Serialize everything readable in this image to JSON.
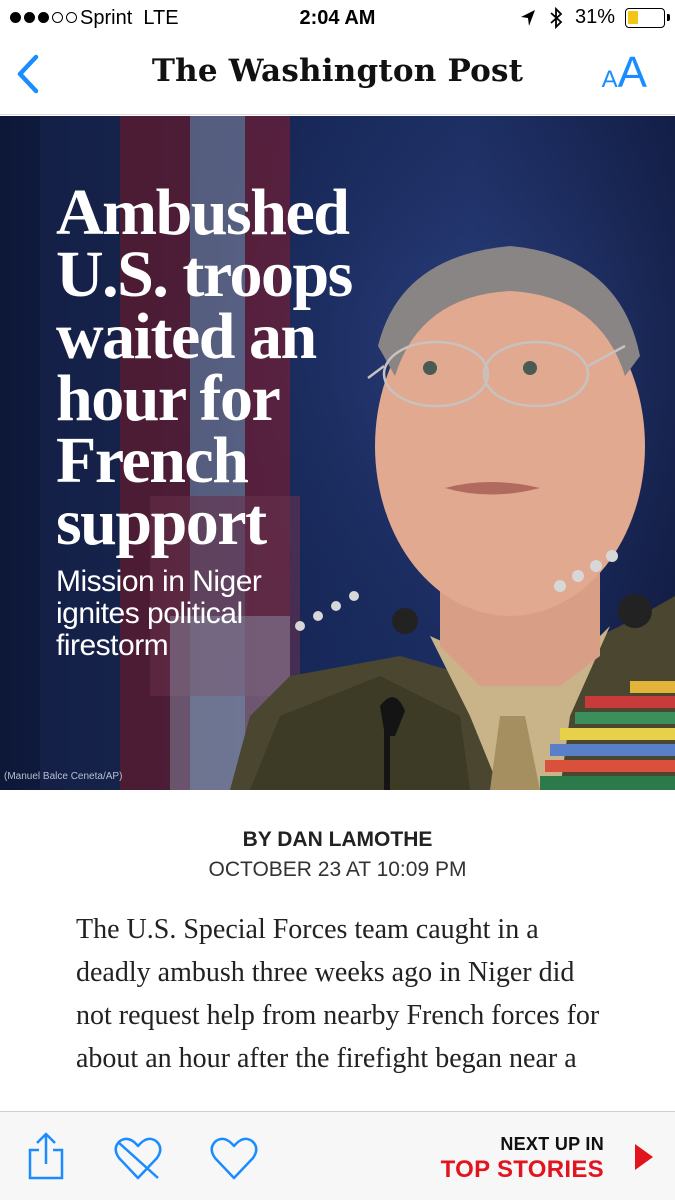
{
  "status_bar": {
    "carrier": "Sprint",
    "network": "LTE",
    "time": "2:04 AM",
    "battery_percent_text": "31%",
    "battery_level": 0.31,
    "signal_bars_filled": 3,
    "signal_bars_total": 5,
    "icons": [
      "location-arrow-icon",
      "bluetooth-icon",
      "battery-icon"
    ],
    "battery_color": "#f3c514"
  },
  "nav": {
    "masthead": "The Washington Post",
    "text_size_small": "A",
    "text_size_large": "A",
    "back_icon": "chevron-left-icon",
    "accent_color": "#1a8cff"
  },
  "hero": {
    "headline": "Ambushed U.S. troops waited an hour for French support",
    "subhead": "Mission in Niger ignites political firestorm",
    "photo_credit": "(Manuel Balce Ceneta/AP)"
  },
  "article": {
    "byline": "BY DAN LAMOTHE",
    "dateline": "OCTOBER 23 AT 10:09 PM",
    "body": "The U.S. Special Forces team caught in a deadly ambush three weeks ago in Niger did not request help from nearby French forces for about an hour after the firefight began near a"
  },
  "toolbar": {
    "share_icon": "share-icon",
    "unlike_icon": "heart-broken-icon",
    "like_icon": "heart-icon",
    "next_up_label": "NEXT UP IN",
    "next_up_section": "TOP STORIES",
    "next_arrow_icon": "play-arrow-icon",
    "accent_red": "#e2141e"
  }
}
